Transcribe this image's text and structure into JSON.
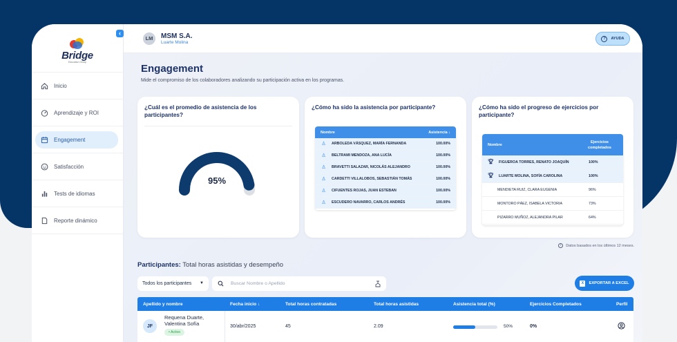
{
  "brand": {
    "logo_text": "Bridge",
    "logo_sub": "Education Group"
  },
  "sidebar": {
    "items": [
      {
        "label": "Inicio",
        "icon": "home-icon"
      },
      {
        "label": "Aprendizaje y ROI",
        "icon": "gauge-icon"
      },
      {
        "label": "Engagement",
        "icon": "calendar-icon",
        "active": true
      },
      {
        "label": "Satisfacción",
        "icon": "smile-icon"
      },
      {
        "label": "Tests de idiomas",
        "icon": "bar-chart-icon"
      },
      {
        "label": "Reporte dinámico",
        "icon": "document-icon"
      }
    ]
  },
  "topbar": {
    "avatar_initials": "LM",
    "company": "MSM S.A.",
    "user": "Luarte Molina",
    "help_label": "AYUDA"
  },
  "page": {
    "title": "Engagement",
    "subtitle": "Mide el compromiso de los colaboradores analizando su participación activa en los programas."
  },
  "card_attendance": {
    "title": "¿Cuál es el promedio de asistencia de los participantes?",
    "value_label": "95%",
    "value": 95
  },
  "card_participants": {
    "title": "¿Cómo ha sido la asistencia por participante?",
    "col_name": "Nombre",
    "col_attendance": "Asistencia",
    "rows": [
      {
        "name": "ARBOLEDA VÁSQUEZ, MARÍA FERNANDA",
        "value": "100.00%"
      },
      {
        "name": "BELTRAMI MENDOZA, ANA LUCÍA",
        "value": "100.00%"
      },
      {
        "name": "BRAVETTI SALAZAR, NICOLÁS ALEJANDRO",
        "value": "100.00%"
      },
      {
        "name": "CARDETTI VILLALOBOS, SEBASTIÁN TOMÁS",
        "value": "100.00%"
      },
      {
        "name": "CIFUENTES ROJAS, JUAN ESTEBAN",
        "value": "100.00%"
      },
      {
        "name": "ESCUDERO NAVARRO, CARLOS ANDRÉS",
        "value": "100.00%"
      }
    ]
  },
  "card_progress": {
    "title": "¿Cómo ha sido el progreso de ejercicios por participante?",
    "col_name": "Nombre",
    "col_exercises": "Ejercicios completados",
    "rows": [
      {
        "name": "FIGUEROA TORRES, RENATO JOAQUÍN",
        "value": "100%",
        "trophy": true
      },
      {
        "name": "LUARTE MOLINA, SOFÍA CAROLINA",
        "value": "100%",
        "trophy": true
      },
      {
        "name": "MENDIETA RUIZ, CLARA EUGENIA",
        "value": "96%",
        "trophy": false
      },
      {
        "name": "MONTORO PÁEZ, ISABELA VICTORIA",
        "value": "73%",
        "trophy": false
      },
      {
        "name": "PIZARRO MUÑOZ, ALEJANDRA PILAR",
        "value": "64%",
        "trophy": false
      }
    ]
  },
  "note": "Datos basados en los últimos 12 meses.",
  "participants": {
    "title_bold": "Participantes:",
    "title_rest": " Total horas asistidas y desempeño",
    "filter_value": "Todos los participantes",
    "search_placeholder": "Buscar Nombre o Apellido",
    "export_label": "EXPORTAR A EXCEL",
    "columns": [
      "Apellido y nombre",
      "Fecha inicio",
      "Total horas contratadas",
      "Total horas asistidas",
      "Asistencia total (%)",
      "Ejercicios Completados",
      "Perfil"
    ],
    "rows": [
      {
        "initials": "JF",
        "name": "Requena Duarte, Valentina Sofía",
        "status": "• Activo",
        "start": "30/abr/2025",
        "contracted": "45",
        "attended": "2.09",
        "attendance_label": "50%",
        "attendance": 50,
        "exercises": "0%"
      }
    ]
  },
  "colors": {
    "navy": "#053566",
    "primary": "#1f7de6",
    "gauge": "#0d3b6e",
    "gauge_track": "#dcdfe4"
  }
}
